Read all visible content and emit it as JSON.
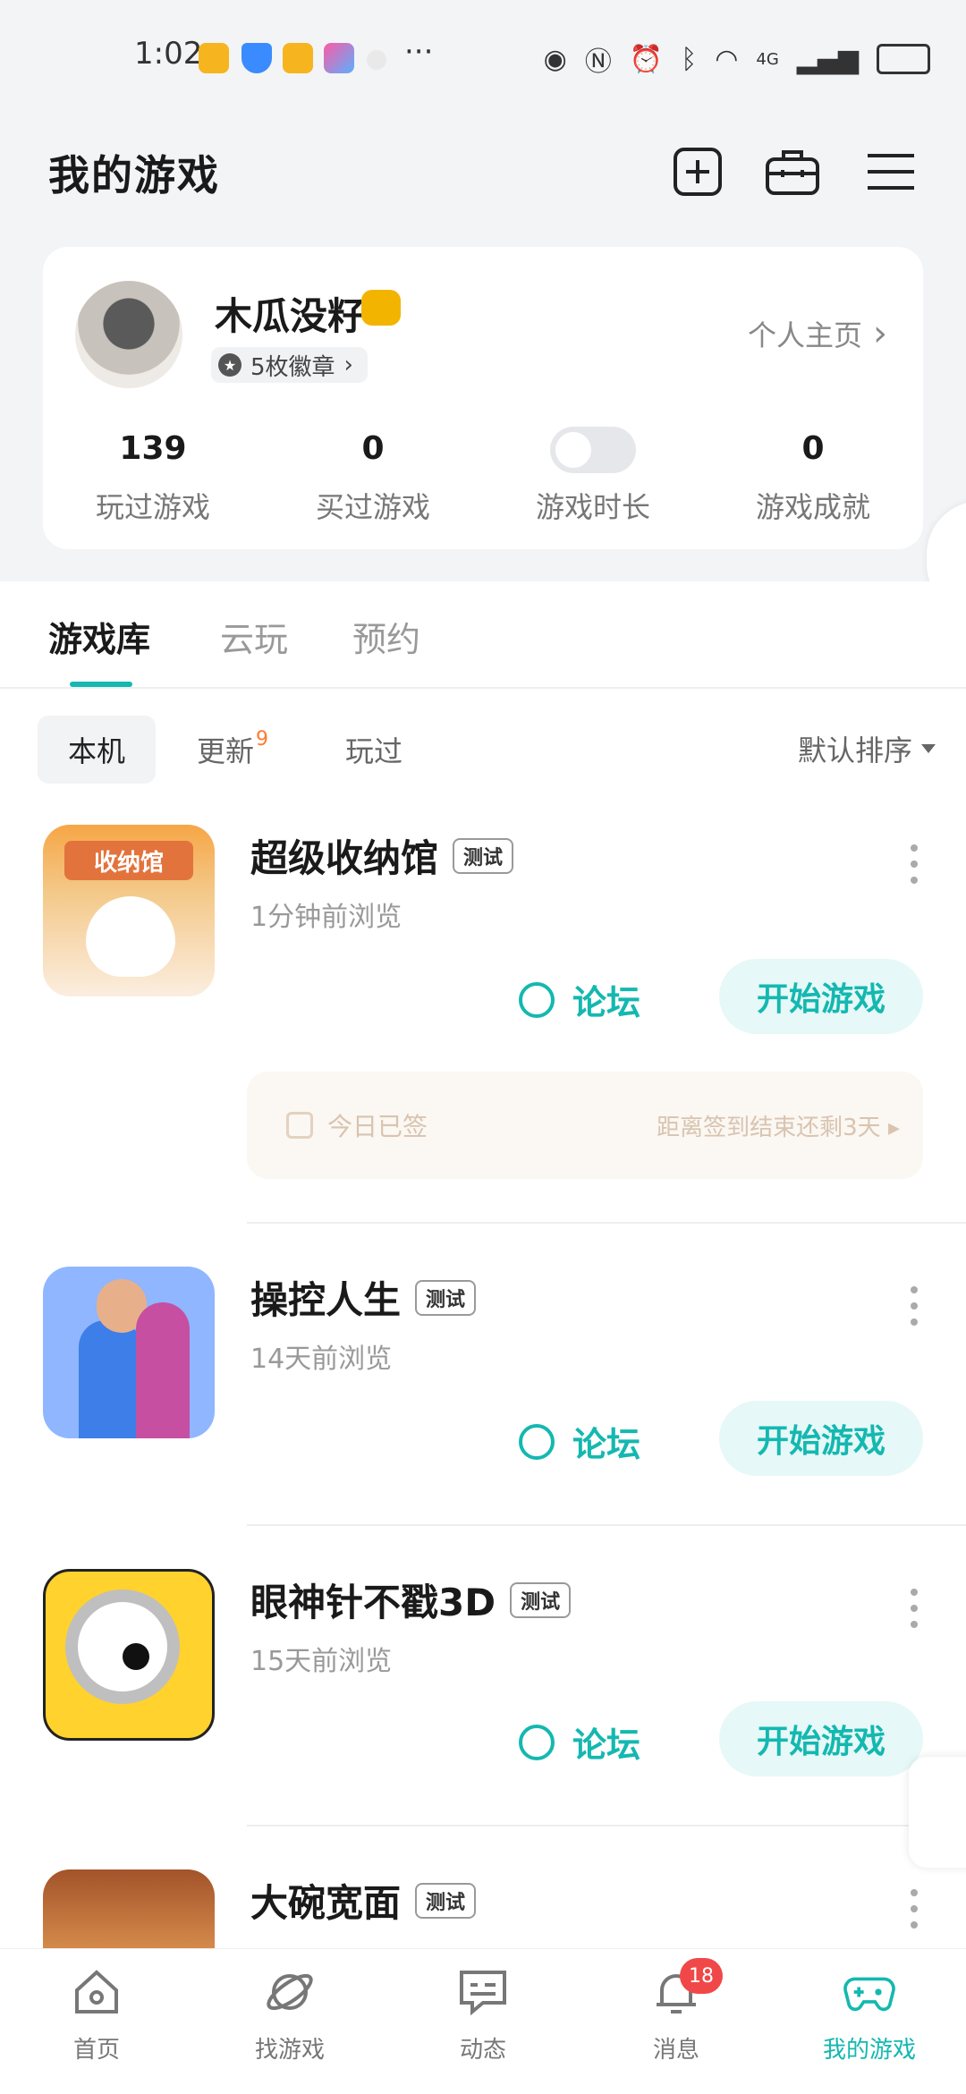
{
  "status_bar": {
    "time": "1:02",
    "dots": "···",
    "network": "4G"
  },
  "header": {
    "title": "我的游戏"
  },
  "profile": {
    "nickname": "木瓜没籽",
    "badges": "5枚徽章",
    "homepage": "个人主页",
    "stats": [
      {
        "num": "139",
        "label": "玩过游戏"
      },
      {
        "num": "0",
        "label": "买过游戏"
      },
      {
        "num": "",
        "label": "游戏时长"
      },
      {
        "num": "0",
        "label": "游戏成就"
      }
    ]
  },
  "tabs": [
    "游戏库",
    "云玩",
    "预约"
  ],
  "filters": {
    "local": "本机",
    "update": "更新",
    "update_count": "9",
    "played": "玩过",
    "sort": "默认排序"
  },
  "games": [
    {
      "name": "超级收纳馆",
      "tag": "测试",
      "time": "1分钟前浏览",
      "forum": "论坛",
      "play": "开始游戏"
    },
    {
      "name": "操控人生",
      "tag": "测试",
      "time": "14天前浏览",
      "forum": "论坛",
      "play": "开始游戏"
    },
    {
      "name": "眼神针不戳3D",
      "tag": "测试",
      "time": "15天前浏览",
      "forum": "论坛",
      "play": "开始游戏"
    },
    {
      "name": "大碗宽面",
      "tag": "测试",
      "time": "",
      "forum": "",
      "play": ""
    }
  ],
  "checkin": {
    "left": "今日已签",
    "right": "距离签到结束还剩3天"
  },
  "game_icon_text": "收纳馆",
  "bottom_nav": [
    {
      "label": "首页",
      "icon": "home-icon"
    },
    {
      "label": "找游戏",
      "icon": "planet-icon"
    },
    {
      "label": "动态",
      "icon": "chat-icon"
    },
    {
      "label": "消息",
      "icon": "bell-icon",
      "badge": "18"
    },
    {
      "label": "我的游戏",
      "icon": "gamepad-icon"
    }
  ],
  "colors": {
    "accent": "#14b8b0",
    "badge": "#f04848",
    "update_dot": "#ff7a2f"
  }
}
